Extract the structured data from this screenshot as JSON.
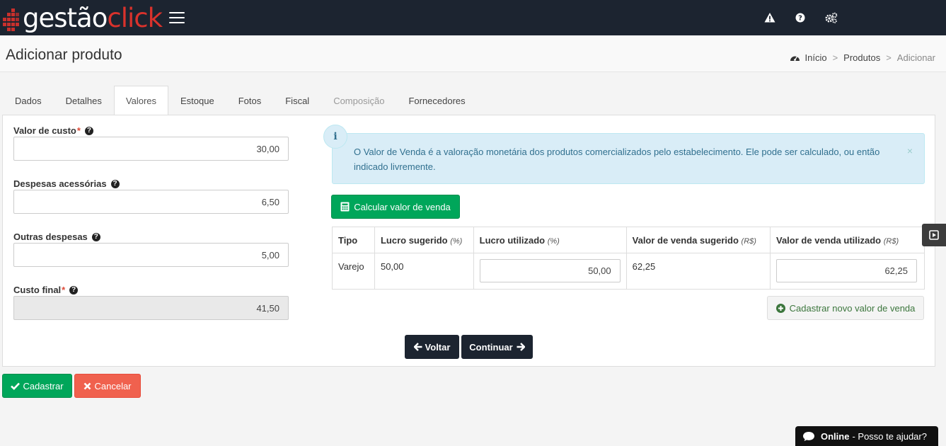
{
  "app": {
    "logo_main": "gestão",
    "logo_accent": "click"
  },
  "header": {
    "icons": [
      "warning-icon",
      "question-icon",
      "gears-icon"
    ]
  },
  "page": {
    "title": "Adicionar produto"
  },
  "breadcrumb": {
    "home": "Início",
    "section": "Produtos",
    "current": "Adicionar",
    "sep": ">"
  },
  "tabs": [
    {
      "label": "Dados"
    },
    {
      "label": "Detalhes"
    },
    {
      "label": "Valores"
    },
    {
      "label": "Estoque"
    },
    {
      "label": "Fotos"
    },
    {
      "label": "Fiscal"
    },
    {
      "label": "Composição"
    },
    {
      "label": "Fornecedores"
    }
  ],
  "form": {
    "custo_label": "Valor de custo",
    "custo_value": "30,00",
    "despesas_label": "Despesas acessórias",
    "despesas_value": "6,50",
    "outras_label": "Outras despesas",
    "outras_value": "5,00",
    "final_label": "Custo final",
    "final_value": "41,50",
    "required_mark": "*"
  },
  "alert": {
    "icon": "i",
    "text": "O Valor de Venda é a valoração monetária dos produtos comercializados pelo estabelecimento. Ele pode ser calculado, ou então indicado livremente.",
    "close": "×"
  },
  "calc_button": "Calcular valor de venda",
  "table": {
    "headers": {
      "tipo": "Tipo",
      "lucro_sugerido": "Lucro sugerido",
      "lucro_sugerido_unit": "(%)",
      "lucro_utilizado": "Lucro utilizado",
      "lucro_utilizado_unit": "(%)",
      "venda_sugerido": "Valor de venda sugerido",
      "venda_sugerido_unit": "(R$)",
      "venda_utilizado": "Valor de venda utilizado",
      "venda_utilizado_unit": "(R$)"
    },
    "rows": [
      {
        "tipo": "Varejo",
        "lucro_sugerido": "50,00",
        "lucro_utilizado": "50,00",
        "venda_sugerido": "62,25",
        "venda_utilizado": "62,25"
      }
    ]
  },
  "add_value_button": "Cadastrar novo valor de venda",
  "nav": {
    "back": "Voltar",
    "next": "Continuar"
  },
  "actions": {
    "submit": "Cadastrar",
    "cancel": "Cancelar"
  },
  "chat": {
    "status": "Online",
    "text": "- Posso te ajudar?"
  },
  "colors": {
    "topbar": "#1c2430",
    "accent_red": "#d9322c",
    "success": "#00a65a",
    "danger": "#f0614e",
    "info_bg": "#d9edf7"
  }
}
